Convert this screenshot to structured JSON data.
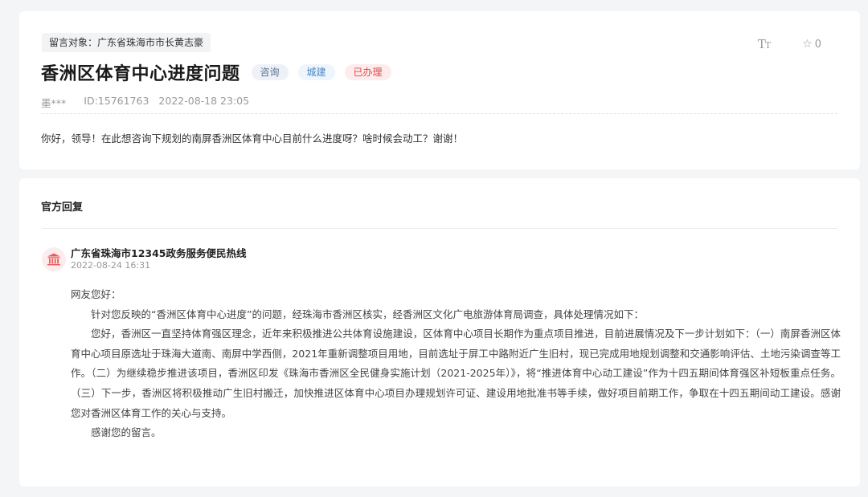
{
  "message": {
    "target_label": "留言对象：广东省珠海市市长黄志豪",
    "title": "香洲区体育中心进度问题",
    "category_badge": "咨询",
    "area_badge": "城建",
    "status_badge": "已办理",
    "author": "墨***",
    "id_text": "ID:15761763",
    "datetime": "2022-08-18 23:05",
    "content": "你好，领导！在此想咨询下规划的南屏香洲区体育中心目前什么进度呀？啥时候会动工？谢谢！",
    "toolbar": {
      "font_size_icon": "font-size-icon",
      "star_icon": "star-outline-icon",
      "like_count": "0"
    }
  },
  "reply": {
    "heading": "官方回复",
    "responder_icon": "government-building-icon",
    "responder": "广东省珠海市12345政务服务便民热线",
    "date": "2022-08-24 16:31",
    "paragraphs": {
      "greeting": "网友您好：",
      "p1": "针对您反映的“香洲区体育中心进度”的问题，经珠海市香洲区核实，经香洲区文化广电旅游体育局调查，具体处理情况如下：",
      "p2": "您好，香洲区一直坚持体育强区理念，近年来积极推进公共体育设施建设，区体育中心项目长期作为重点项目推进，目前进展情况及下一步计划如下：（一）南屏香洲区体育中心项目原选址于珠海大道南、南屏中学西侧，2021年重新调整项目用地，目前选址于屏工中路附近广生旧村，现已完成用地规划调整和交通影响评估、土地污染调查等工作。（二）为继续稳步推进该项目，香洲区印发《珠海市香洲区全民健身实施计划（2021-2025年）》，将“推进体育中心动工建设”作为十四五期间体育强区补短板重点任务。（三）下一步，香洲区将积极推动广生旧村搬迁，加快推进区体育中心项目办理规划许可证、建设用地批准书等手续，做好项目前期工作，争取在十四五期间动工建设。感谢您对香洲区体育工作的关心与支持。",
      "closing": "感谢您的留言。"
    }
  }
}
